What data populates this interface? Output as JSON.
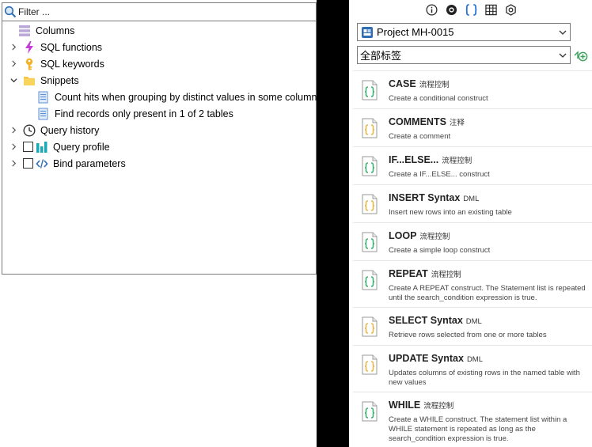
{
  "filter": {
    "placeholder": "Filter ..."
  },
  "tree": {
    "columns": "Columns",
    "sql_functions": "SQL functions",
    "sql_keywords": "SQL keywords",
    "snippets": "Snippets",
    "snippet_1": "Count hits when grouping by distinct values in some column",
    "snippet_2": "Find records only present in 1 of 2 tables",
    "query_history": "Query history",
    "query_profile": "Query profile",
    "bind_parameters": "Bind parameters"
  },
  "right": {
    "project": "Project MH-0015",
    "tag_filter": "全部标签"
  },
  "snippets": [
    {
      "title": "CASE",
      "tag": "流程控制",
      "desc": "Create a conditional construct",
      "accent": "#3cb371"
    },
    {
      "title": "COMMENTS",
      "tag": "注释",
      "desc": "Create a comment",
      "accent": "#e8b84a"
    },
    {
      "title": "IF...ELSE...",
      "tag": "流程控制",
      "desc": "Create a IF...ELSE... construct",
      "accent": "#3cb371"
    },
    {
      "title": "INSERT Syntax",
      "tag": "DML",
      "desc": "Insert new rows into an existing table",
      "accent": "#e8b84a"
    },
    {
      "title": "LOOP",
      "tag": "流程控制",
      "desc": "Create a simple loop construct",
      "accent": "#3cb371"
    },
    {
      "title": "REPEAT",
      "tag": "流程控制",
      "desc": "Create A REPEAT construct. The Statement list is repeated until the search_condition expression is true.",
      "accent": "#3cb371"
    },
    {
      "title": "SELECT Syntax",
      "tag": "DML",
      "desc": "Retrieve rows selected from one or more tables",
      "accent": "#e8b84a"
    },
    {
      "title": "UPDATE Syntax",
      "tag": "DML",
      "desc": "Updates columns of existing rows in the named table with new values",
      "accent": "#e8b84a"
    },
    {
      "title": "WHILE",
      "tag": "流程控制",
      "desc": "Create a WHILE construct. The statement list within a WHILE statement is repeated as long as the search_condition expression is true.",
      "accent": "#3cb371"
    }
  ]
}
